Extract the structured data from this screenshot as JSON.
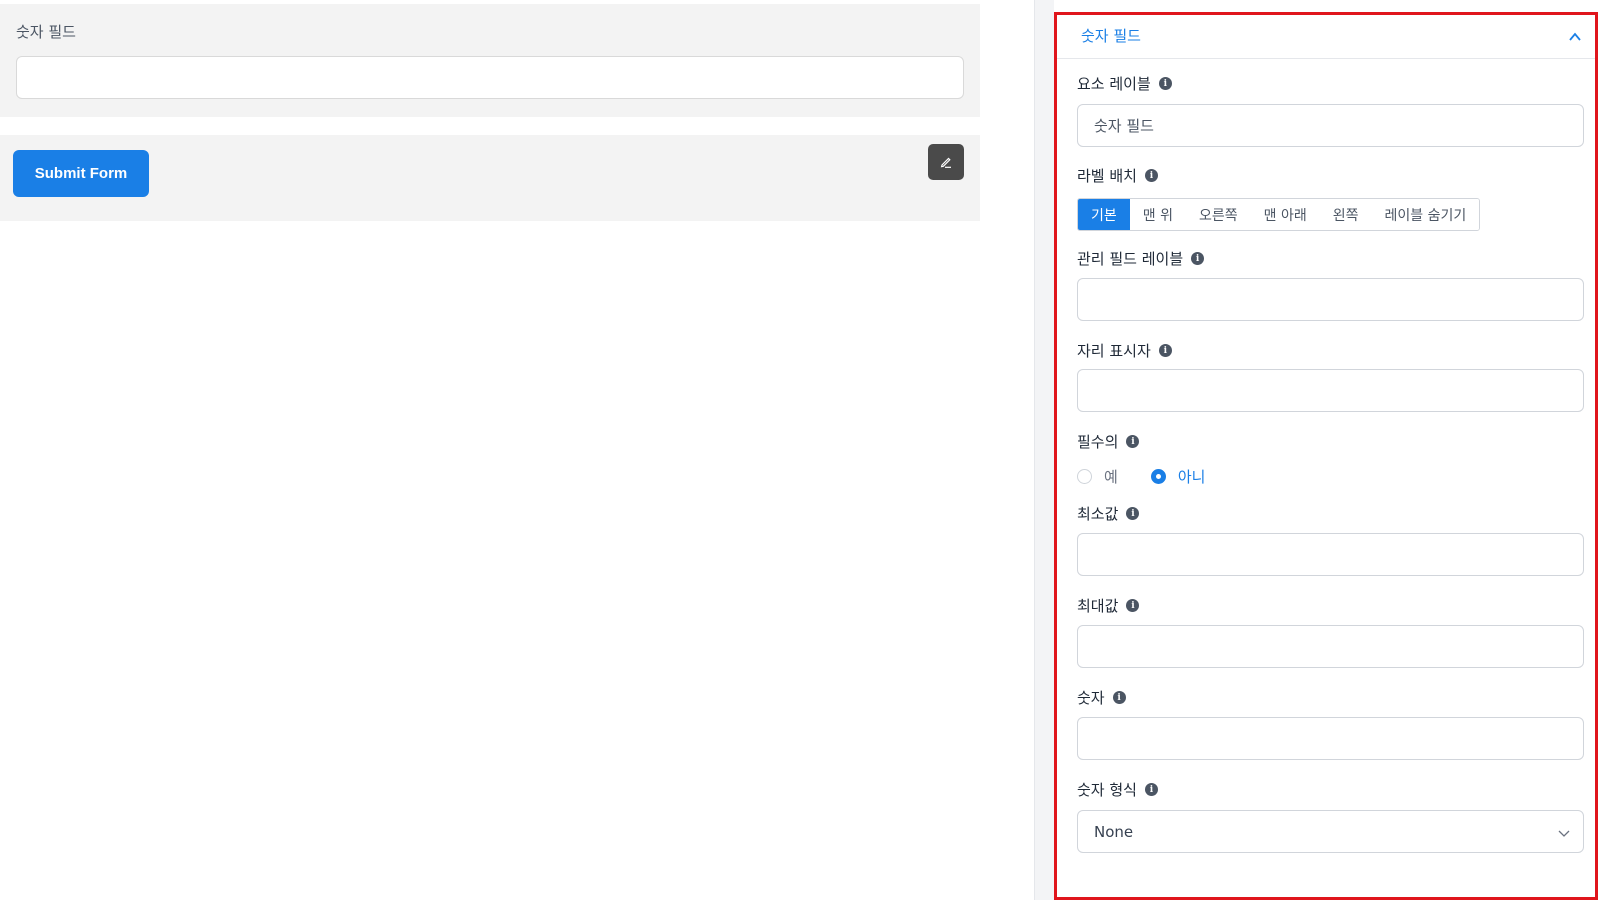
{
  "canvas": {
    "number_field_label": "숫자 필드",
    "submit_button_label": "Submit Form"
  },
  "panel": {
    "title": "숫자 필드",
    "element_label": {
      "label": "요소 레이블",
      "value": "숫자 필드"
    },
    "label_placement": {
      "label": "라벨 배치",
      "options": [
        "기본",
        "맨 위",
        "오른쪽",
        "맨 아래",
        "왼쪽",
        "레이블 숨기기"
      ],
      "selected": "기본"
    },
    "admin_field_label": {
      "label": "관리 필드 레이블",
      "value": ""
    },
    "placeholder": {
      "label": "자리 표시자",
      "value": ""
    },
    "required": {
      "label": "필수의",
      "options": [
        "예",
        "아니"
      ],
      "selected": "아니"
    },
    "min_value": {
      "label": "최소값",
      "value": ""
    },
    "max_value": {
      "label": "최대값",
      "value": ""
    },
    "number": {
      "label": "숫자",
      "value": ""
    },
    "number_format": {
      "label": "숫자 형식",
      "value": "None"
    }
  },
  "colors": {
    "accent": "#1a7fe6",
    "highlight_border": "#e0151c",
    "canvas_block_bg": "#f3f3f3",
    "edit_button_bg": "#4a4a4a"
  },
  "icons": {
    "info": "info-icon",
    "collapse": "chevron-up-icon",
    "edit": "pencil-icon",
    "select_caret": "chevron-down-icon"
  }
}
